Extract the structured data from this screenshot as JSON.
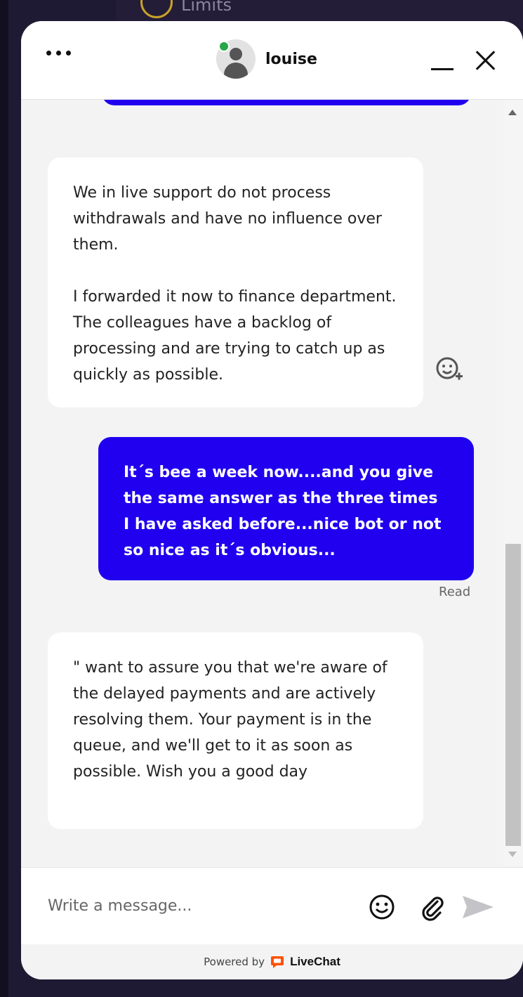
{
  "background": {
    "limits_label": "Limits"
  },
  "header": {
    "agent_name": "louise",
    "status": "online",
    "status_color": "#27a745",
    "menu_icon": "more-dots-icon",
    "minimize_icon": "minimize-icon",
    "close_icon": "close-icon"
  },
  "messages": [
    {
      "author": "agent",
      "text": "We in live support do not process withdrawals and have no influence over them.\n\nI forwarded it now to finance department. The colleagues have a backlog of processing and are trying to catch up as quickly as possible."
    },
    {
      "author": "user",
      "text": "It´s bee a week now....and you give the same answer as the three times I have asked before...nice bot or not so nice as it´s obvious...",
      "status": "Read"
    },
    {
      "author": "agent",
      "text": "\" want to assure you that we're aware of the delayed payments and are actively resolving them. Your payment is in the queue, and we'll get to it as soon as possible. Wish you a good day"
    }
  ],
  "composer": {
    "placeholder": "Write a message..."
  },
  "footer": {
    "powered_by": "Powered by",
    "brand": "LiveChat",
    "brand_color": "#ff5100"
  },
  "colors": {
    "user_bubble": "#2000ee",
    "agent_bubble": "#ffffff",
    "chat_background": "#f3f3f4"
  }
}
